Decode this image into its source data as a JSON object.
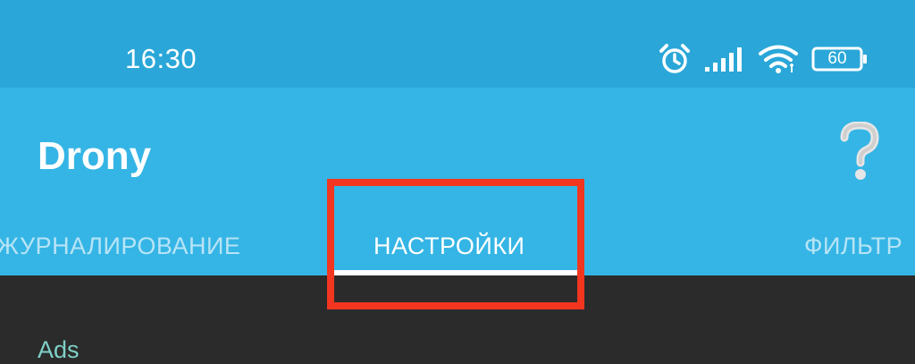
{
  "status_bar": {
    "time": "16:30",
    "battery_level": "60",
    "icons": [
      "alarm-icon",
      "signal-icon",
      "wifi-icon",
      "battery-icon"
    ]
  },
  "app_bar": {
    "title": "Drony",
    "help_icon": "question-mark-icon"
  },
  "tabs": [
    {
      "label": "ЖУРНАЛИРОВАНИЕ",
      "active": false
    },
    {
      "label": "НАСТРОЙКИ",
      "active": true
    },
    {
      "label": "ФИЛЬТР",
      "active": false
    }
  ],
  "content": {
    "section_header": "Ads"
  },
  "colors": {
    "status_bar": "#2aa7d8",
    "app_bar": "#35b5e5",
    "content_bg": "#2b2b2b",
    "highlight": "#f2361f",
    "section_header": "#7fd0c7"
  }
}
